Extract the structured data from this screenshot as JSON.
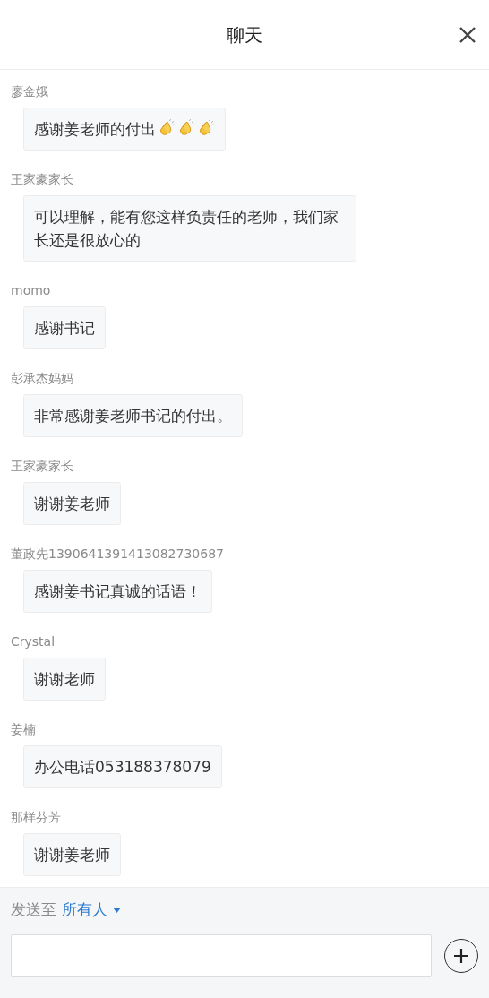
{
  "header": {
    "title": "聊天"
  },
  "messages": [
    {
      "sender": "廖金娥",
      "text": "感谢姜老师的付出",
      "trailing_icons": [
        {
          "kind": "clap"
        },
        {
          "kind": "clap"
        },
        {
          "kind": "clap"
        }
      ]
    },
    {
      "sender": "王家豪家长",
      "text": "可以理解，能有您这样负责任的老师，我们家长还是很放心的"
    },
    {
      "sender": "momo",
      "text": "感谢书记"
    },
    {
      "sender": "彭承杰妈妈",
      "text": "非常感谢姜老师书记的付出。"
    },
    {
      "sender": "王家豪家长",
      "text": "谢谢姜老师"
    },
    {
      "sender": "董政先1390641391413082730687",
      "text": "感谢姜书记真诚的话语！"
    },
    {
      "sender": "Crystal",
      "text": "谢谢老师"
    },
    {
      "sender": "姜楠",
      "text": "办公电话053188378079"
    },
    {
      "sender": "那样芬芳",
      "text": "谢谢姜老师"
    }
  ],
  "composer": {
    "label": "发送至",
    "recipient": "所有人"
  }
}
